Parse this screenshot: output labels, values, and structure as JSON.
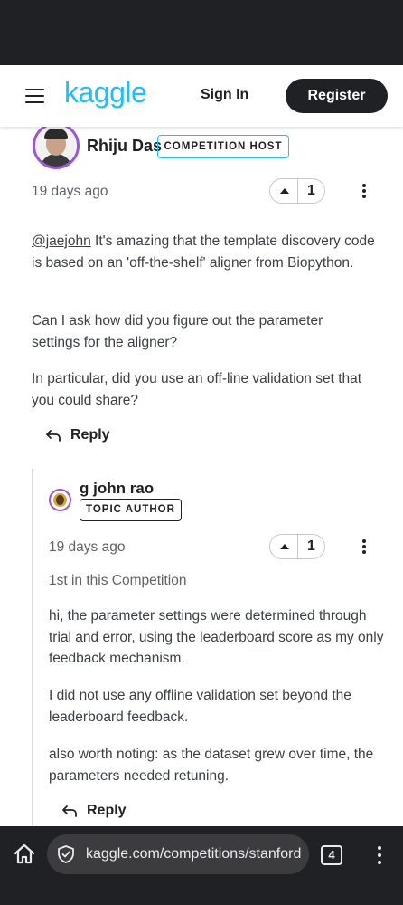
{
  "header": {
    "logo_text": "kaggle",
    "sign_in_label": "Sign In",
    "register_label": "Register"
  },
  "comment": {
    "author": "Rhiju Das",
    "badge": "COMPETITION HOST",
    "timestamp": "19 days ago",
    "votes": "1",
    "mention": "@jaejohn",
    "paragraph1_rest": " It's amazing that the template discovery code is based on an 'off-the-shelf' aligner from Biopython.",
    "paragraph2": "Can I ask how did you figure out the parameter settings for the aligner?",
    "paragraph3": "In particular, did you use an off-line validation set that you could share?",
    "reply_label": "Reply"
  },
  "reply": {
    "author": "g john rao",
    "badge": "TOPIC AUTHOR",
    "timestamp": "19 days ago",
    "votes": "1",
    "rank": "1st in this Competition",
    "paragraph1": "hi, the parameter settings were determined through trial and error, using the leaderboard score as my only feedback mechanism.",
    "paragraph2": "I did not use any offline validation set beyond the leaderboard feedback.",
    "paragraph3": "also worth noting: as the dataset grew over time, the parameters needed retuning.",
    "reply_label": "Reply"
  },
  "browser": {
    "url": "kaggle.com/competitions/stanford",
    "tab_count": "4"
  },
  "colors": {
    "brand": "#20beff",
    "dark": "#202124",
    "avatar_ring": "#9b59d0"
  }
}
